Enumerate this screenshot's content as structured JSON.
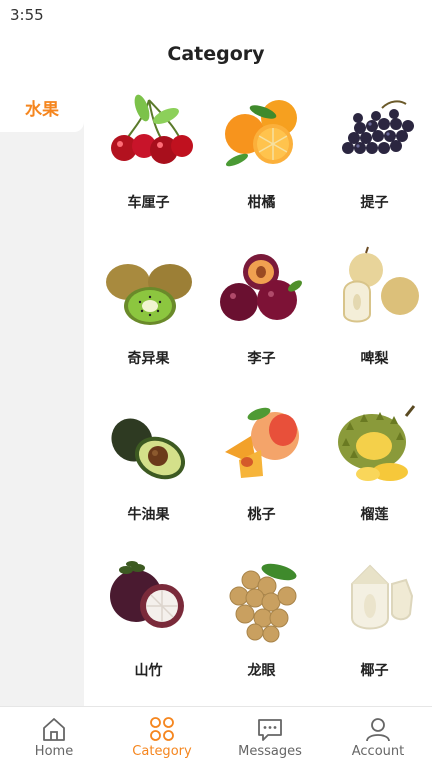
{
  "status_bar": {
    "time": "3:55"
  },
  "header": {
    "title": "Category"
  },
  "sidebar": {
    "items": [
      {
        "label": "水果",
        "selected": true
      }
    ]
  },
  "products": [
    {
      "name": "车厘子",
      "icon": "cherries-image"
    },
    {
      "name": "柑橘",
      "icon": "mandarin-orange-image"
    },
    {
      "name": "提子",
      "icon": "grapes-image"
    },
    {
      "name": "奇异果",
      "icon": "kiwi-image"
    },
    {
      "name": "李子",
      "icon": "plums-image"
    },
    {
      "name": "啤梨",
      "icon": "pears-image"
    },
    {
      "name": "牛油果",
      "icon": "avocado-image"
    },
    {
      "name": "桃子",
      "icon": "peaches-image"
    },
    {
      "name": "榴莲",
      "icon": "durian-image"
    },
    {
      "name": "山竹",
      "icon": "mangosteen-image"
    },
    {
      "name": "龙眼",
      "icon": "longan-image"
    },
    {
      "name": "椰子",
      "icon": "coconut-image"
    }
  ],
  "tab_bar": {
    "tabs": [
      {
        "label": "Home",
        "icon": "home-icon"
      },
      {
        "label": "Category",
        "icon": "category-icon",
        "active": true
      },
      {
        "label": "Messages",
        "icon": "messages-icon"
      },
      {
        "label": "Account",
        "icon": "account-icon"
      }
    ]
  },
  "colors": {
    "accent": "#f5861f",
    "sidebar_bg": "#f2f2f2",
    "text": "#222222"
  }
}
